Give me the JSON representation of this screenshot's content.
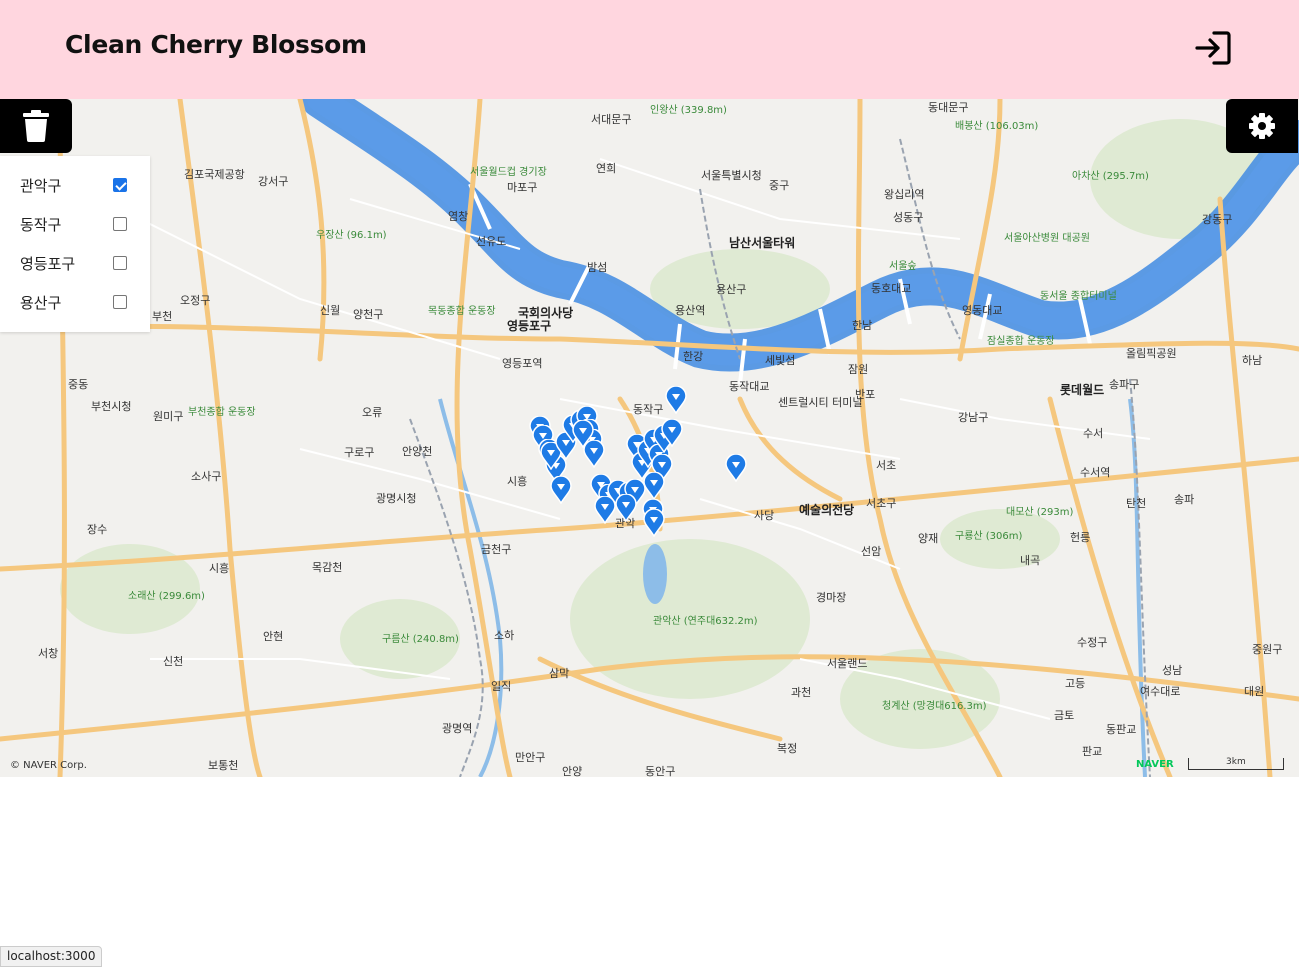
{
  "app": {
    "title": "Clean Cherry Blossom",
    "header_color": "#ffd6df"
  },
  "icons": {
    "login": "login-icon",
    "trash": "trash-icon",
    "gear": "gear-icon",
    "marker": "map-marker-icon"
  },
  "filters": [
    {
      "label": "관악구",
      "checked": true
    },
    {
      "label": "동작구",
      "checked": false
    },
    {
      "label": "영등포구",
      "checked": false
    },
    {
      "label": "용산구",
      "checked": false
    }
  ],
  "map": {
    "copyright": "© NAVER Corp.",
    "provider": "NAVER",
    "scale": "3km",
    "labels": [
      "서대문구",
      "인왕산 (339.8m)",
      "동대문구",
      "배봉산 (106.03m)",
      "김포국제공항",
      "강서구",
      "서울월드컵 경기장",
      "마포구",
      "연희",
      "서울특별시청",
      "중구",
      "왕십리역",
      "아차산 (295.7m)",
      "우장산 (96.1m)",
      "염창",
      "선유도",
      "남산서울타워",
      "성동구",
      "서울아산병원 대공원",
      "강동구",
      "밤섬",
      "서울숲",
      "오정구",
      "신월",
      "양천구",
      "목동종합 운동장",
      "국회의사당",
      "영등포구",
      "용산구",
      "용산역",
      "동호대교",
      "영동대교",
      "동서울 종합터미널",
      "부천",
      "영등포역",
      "한강",
      "세빛섬",
      "한남",
      "잠실종합 운동장",
      "올림픽공원",
      "롯데월드",
      "송파구",
      "중동",
      "부천시청",
      "원미구",
      "부천종합 운동장",
      "오류",
      "동작대교",
      "센트럴시티 터미널",
      "반포",
      "잠원",
      "하남",
      "동작구",
      "강남구",
      "수서",
      "구로구",
      "안양천",
      "시흥",
      "서초",
      "서초구",
      "대모산 (293m)",
      "수서역",
      "탄천",
      "송파",
      "소사구",
      "광명시청",
      "예술의전당",
      "사당",
      "양재",
      "구룡산 (306m)",
      "헌릉",
      "장수",
      "금천구",
      "선암",
      "내곡",
      "시흥",
      "목감천",
      "소래산 (299.6m)",
      "경마장",
      "관악산 (연주대632.2m)",
      "안현",
      "구름산 (240.8m)",
      "소하",
      "서울랜드",
      "수정구",
      "중원구",
      "서창",
      "신천",
      "일직",
      "삼막",
      "과천",
      "청계산 (망경대616.3m)",
      "고등",
      "성남",
      "여수대로",
      "대원",
      "광명역",
      "만안구",
      "복정",
      "안양",
      "금토",
      "판교",
      "동판교",
      "보통천",
      "동안구",
      "관악"
    ]
  },
  "status": {
    "url": "localhost:3000"
  }
}
